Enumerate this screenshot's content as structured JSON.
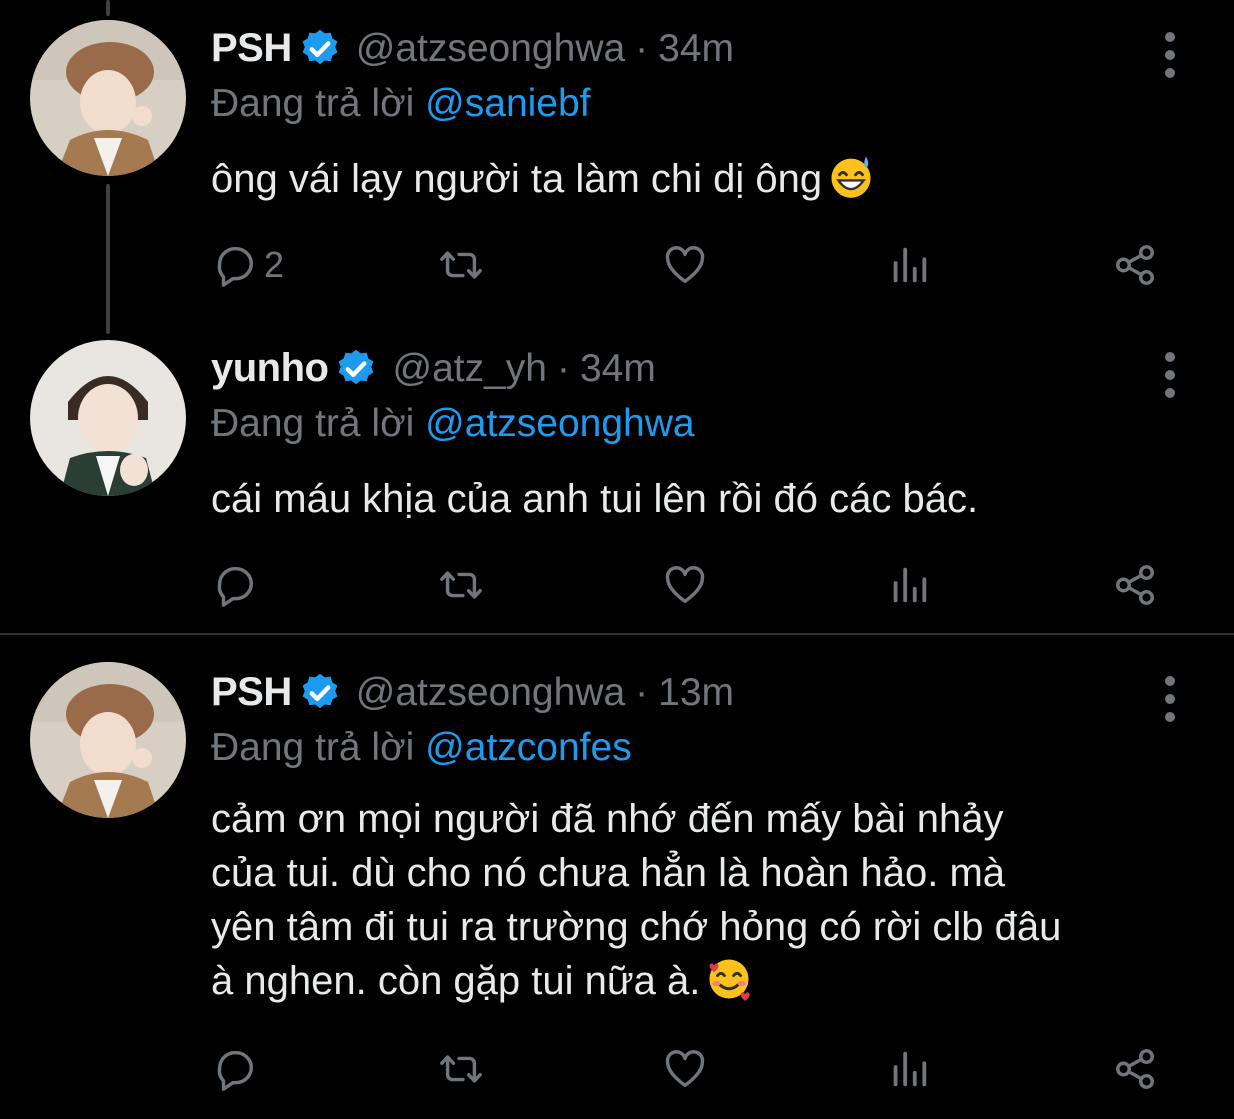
{
  "tweets": [
    {
      "name": "PSH",
      "handle": "@atzseonghwa",
      "dot": "·",
      "time": "34m",
      "reply_prefix": "Đang trả lời",
      "reply_to": "@saniebf",
      "text": "ông vái lạy người ta làm chi dị ông",
      "emoji": "grinning-sweat-emoji",
      "reply_count": "2"
    },
    {
      "name": "yunho",
      "handle": "@atz_yh",
      "dot": "·",
      "time": "34m",
      "reply_prefix": "Đang trả lời",
      "reply_to": "@atzseonghwa",
      "text": "cái máu khịa của anh tui lên rồi đó các bác.",
      "reply_count": ""
    },
    {
      "name": "PSH",
      "handle": "@atzseonghwa",
      "dot": "·",
      "time": "13m",
      "reply_prefix": "Đang trả lời",
      "reply_to": "@atzconfes",
      "text_lines": [
        "cảm ơn mọi người đã nhớ đến mấy bài nhảy",
        "của tui. dù cho nó chưa hẳn là hoàn hảo. mà",
        "yên tâm đi tui ra trường chớ hỏng có rời clb đâu",
        "à nghen. còn gặp tui nữa à."
      ],
      "emoji": "smiling-face-with-hearts-emoji",
      "reply_count": ""
    }
  ],
  "icons": {
    "reply": "reply-icon",
    "retweet": "retweet-icon",
    "like": "heart-icon",
    "analytics": "analytics-icon",
    "share": "share-icon",
    "more": "more-vertical-icon",
    "verified": "verified-badge-icon"
  },
  "colors": {
    "background": "#000000",
    "text": "#e7e9ea",
    "muted": "#71767b",
    "accent": "#1d9bf0",
    "divider": "#2f3336",
    "thread_line": "#3d4144"
  }
}
